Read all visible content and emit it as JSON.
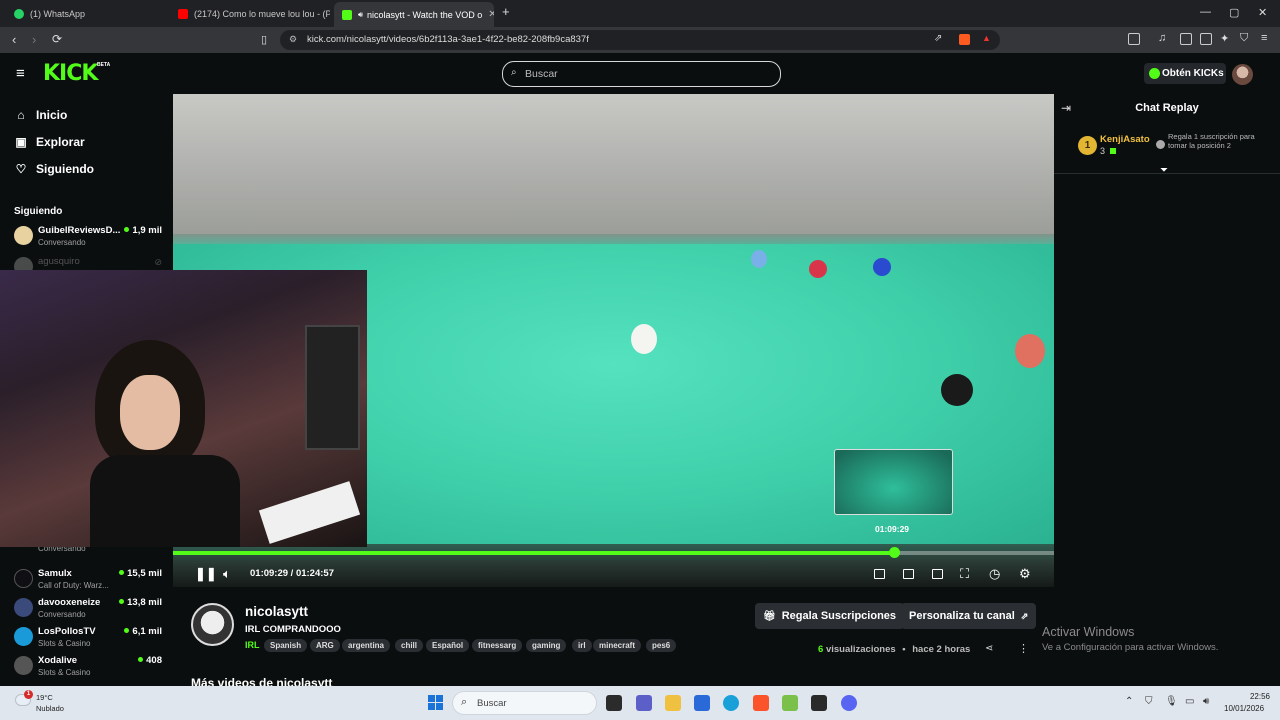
{
  "browser": {
    "tabs": [
      {
        "title": "(1) WhatsApp",
        "color": "#25d366"
      },
      {
        "title": "(2174) Como lo mueve lou lou - (Po",
        "color": "#ff0000"
      },
      {
        "title": "nicolasytt - Watch the VOD o",
        "color": "#53fc18"
      }
    ],
    "url": "kick.com/nicolasytt/videos/6b2f113a-3ae1-4f22-be82-208fb9ca837f"
  },
  "header": {
    "logo": "KICK",
    "logo_badge": "BETA",
    "search_placeholder": "Buscar",
    "kicks_button": "Obtén KICKs"
  },
  "sidebar": {
    "nav": [
      {
        "label": "Inicio",
        "icon": "home-icon"
      },
      {
        "label": "Explorar",
        "icon": "compass-icon"
      },
      {
        "label": "Siguiendo",
        "icon": "heart-icon"
      }
    ],
    "following_title": "Siguiendo",
    "following_top": [
      {
        "name": "GuibelReviewsD...",
        "category": "Conversando",
        "viewers": "1,9 mil"
      },
      {
        "name": "agusquiro",
        "category": "",
        "viewers": ""
      }
    ],
    "following_bottom": [
      {
        "name": "Samulx",
        "category": "Call of Duty: Warz...",
        "viewers": "15,5 mil"
      },
      {
        "name": "davooxeneize",
        "category": "Conversando",
        "viewers": "13,8 mil"
      },
      {
        "name": "LosPollosTV",
        "category": "Slots & Casino",
        "viewers": "6,1 mil"
      },
      {
        "name": "Xodalive",
        "category": "Slots & Casino",
        "viewers": "408"
      }
    ],
    "partial_category": "Conversando"
  },
  "player": {
    "current_time": "01:09:29",
    "duration": "01:24:57",
    "time_label": "01:09:29 / 01:24:57",
    "hover_time": "01:09:29",
    "progress": 0.818
  },
  "chat": {
    "title": "Chat Replay",
    "pinned": {
      "rank": "1",
      "user": "KenjiAsato",
      "count": "3",
      "message": "Regala 1 suscripción para tomar la posición 2"
    }
  },
  "stream": {
    "streamer": "nicolasytt",
    "title": "IRL COMPRANDOOO",
    "category": "IRL",
    "tags": [
      "Spanish",
      "ARG",
      "argentina",
      "chill",
      "Español",
      "fitnessarg",
      "gaming",
      "irl",
      "minecraft",
      "pes6"
    ],
    "gift_button": "Regala Suscripciones",
    "customize_button": "Personaliza tu canal",
    "views_count": "6",
    "views_label": "visualizaciones",
    "age": "hace 2 horas",
    "more_videos": "Más videos de nicolasytt"
  },
  "watermark": {
    "line1": "Activar Windows",
    "line2": "Ve a Configuración para activar Windows."
  },
  "taskbar": {
    "weather_temp": "19°C",
    "weather_desc": "Nublado",
    "weather_badge": "1",
    "search": "Buscar",
    "time": "22:56",
    "date": "10/01/2026"
  },
  "colors": {
    "accent": "#53fc18",
    "background": "#0b0e0f",
    "rank_gold": "#e2b632"
  }
}
